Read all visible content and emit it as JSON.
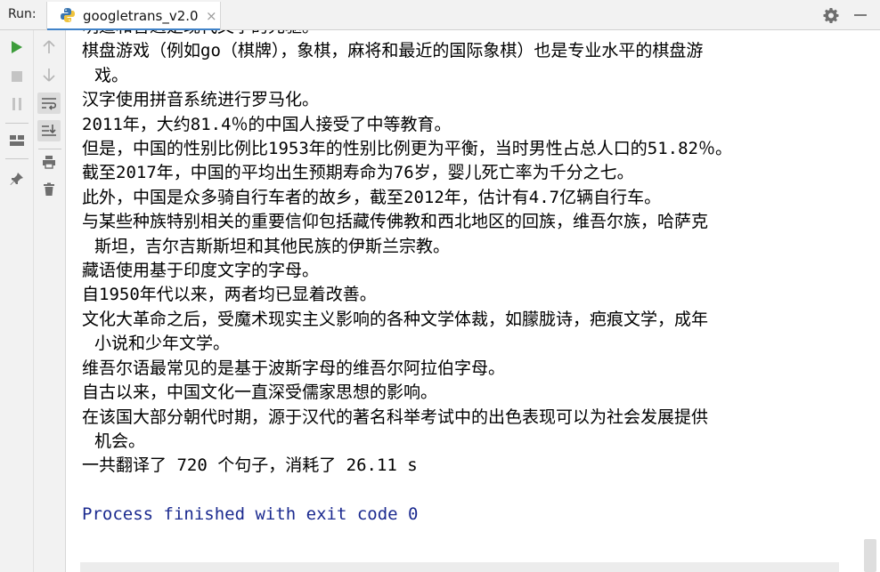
{
  "header": {
    "run_label": "Run:",
    "tab_name": "googletrans_v2.0",
    "tab_close": "×"
  },
  "toolbar": {
    "left": [
      "run-icon",
      "stop-icon",
      "pause-icon",
      "layout-icon",
      "pin-icon"
    ],
    "right": [
      "arrow-up-icon",
      "arrow-down-icon",
      "soft-wrap-icon",
      "scroll-to-end-icon",
      "print-icon",
      "trash-icon"
    ]
  },
  "colors": {
    "run_green": "#3d9c3b",
    "process_text": "#1b2a8f",
    "tab_underline": "#4083c9"
  },
  "console": {
    "lines": [
      {
        "text": "明道和音適是现代文字的先驱。",
        "wrap": false
      },
      {
        "text": "棋盘游戏（例如go（棋牌），象棋，麻将和最近的国际象棋）也是专业水平的棋盘游",
        "wrap": false
      },
      {
        "text": "戏。",
        "wrap": true
      },
      {
        "text": "汉字使用拼音系统进行罗马化。",
        "wrap": false
      },
      {
        "text": "2011年，大约81.4％的中国人接受了中等教育。",
        "wrap": false
      },
      {
        "text": "但是，中国的性别比例比1953年的性别比例更为平衡，当时男性占总人口的51.82％。",
        "wrap": false
      },
      {
        "text": "截至2017年，中国的平均出生预期寿命为76岁，婴儿死亡率为千分之七。",
        "wrap": false
      },
      {
        "text": "此外，中国是众多骑自行车者的故乡，截至2012年，估计有4.7亿辆自行车。",
        "wrap": false
      },
      {
        "text": "与某些种族特别相关的重要信仰包括藏传佛教和西北地区的回族，维吾尔族，哈萨克",
        "wrap": false
      },
      {
        "text": "斯坦，吉尔吉斯斯坦和其他民族的伊斯兰宗教。",
        "wrap": true
      },
      {
        "text": "藏语使用基于印度文字的字母。",
        "wrap": false
      },
      {
        "text": "自1950年代以来，两者均已显着改善。",
        "wrap": false
      },
      {
        "text": "文化大革命之后，受魔术现实主义影响的各种文学体裁，如朦胧诗，疤痕文学，成年",
        "wrap": false
      },
      {
        "text": "小说和少年文学。",
        "wrap": true
      },
      {
        "text": "维吾尔语最常见的是基于波斯字母的维吾尔阿拉伯字母。",
        "wrap": false
      },
      {
        "text": "自古以来，中国文化一直深受儒家思想的影响。",
        "wrap": false
      },
      {
        "text": "在该国大部分朝代时期，源于汉代的著名科举考试中的出色表现可以为社会发展提供",
        "wrap": false
      },
      {
        "text": "机会。",
        "wrap": true
      },
      {
        "text": "一共翻译了 720 个句子，消耗了 26.11 s",
        "wrap": false
      }
    ],
    "process_line": "Process finished with exit code 0"
  }
}
